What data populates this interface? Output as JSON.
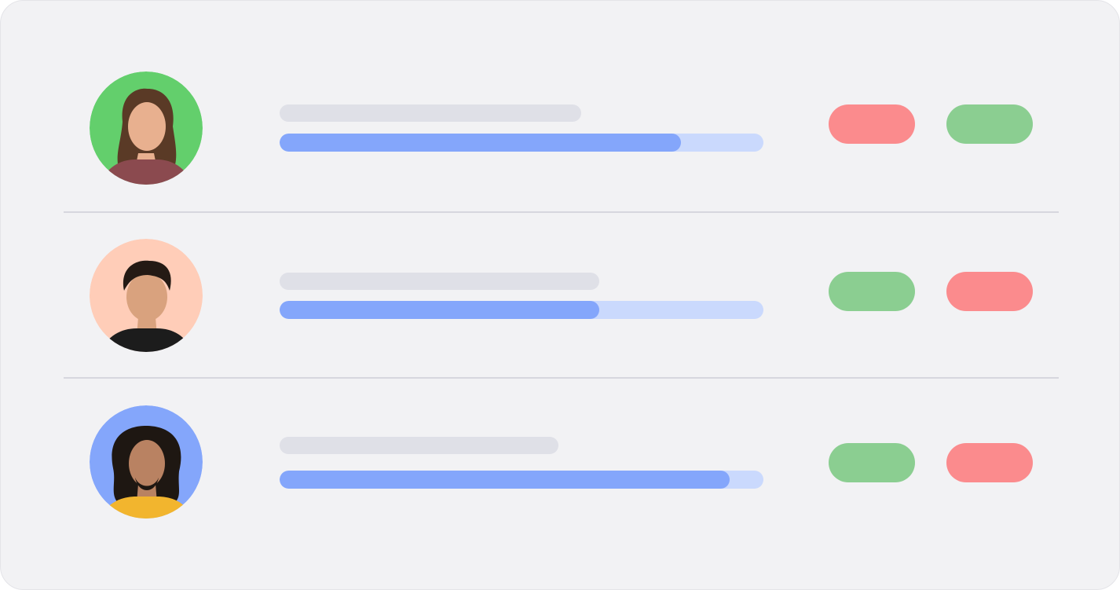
{
  "colors": {
    "background": "#f2f2f4",
    "skeleton": "#dfe0e7",
    "progress_track": "#cad9fd",
    "progress_fill": "#84a6fb",
    "reject": "#fb8b8d",
    "approve": "#8bce91",
    "divider": "#d6d6de"
  },
  "rows": [
    {
      "avatar": {
        "background": "#63cf6c",
        "shirt": "#8b4a4f",
        "hair": "#5a3a26",
        "skin": "#e8b08f"
      },
      "progress": 0.83,
      "actions": [
        {
          "icon": "reject-icon",
          "color": "#fb8b8d"
        },
        {
          "icon": "approve-icon",
          "color": "#8bce91"
        }
      ]
    },
    {
      "avatar": {
        "background": "#ffcdb8",
        "shirt": "#1c1c1c",
        "hair": "#241a14",
        "skin": "#d9a27e"
      },
      "progress": 0.66,
      "actions": [
        {
          "icon": "approve-icon",
          "color": "#8bce91"
        },
        {
          "icon": "reject-icon",
          "color": "#fb8b8d"
        }
      ]
    },
    {
      "avatar": {
        "background": "#84a6fb",
        "shirt": "#f2b52e",
        "hair": "#1e1712",
        "skin": "#b98262"
      },
      "progress": 0.93,
      "actions": [
        {
          "icon": "approve-icon",
          "color": "#8bce91"
        },
        {
          "icon": "reject-icon",
          "color": "#fb8b8d"
        }
      ]
    }
  ]
}
